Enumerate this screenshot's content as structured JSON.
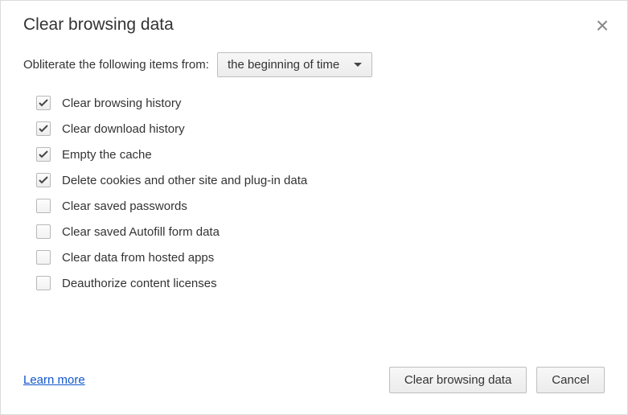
{
  "dialog": {
    "title": "Clear browsing data",
    "close_icon": "close-icon"
  },
  "prompt": {
    "label": "Obliterate the following items from:",
    "time_range_selected": "the beginning of time"
  },
  "options": [
    {
      "label": "Clear browsing history",
      "checked": true
    },
    {
      "label": "Clear download history",
      "checked": true
    },
    {
      "label": "Empty the cache",
      "checked": true
    },
    {
      "label": "Delete cookies and other site and plug-in data",
      "checked": true
    },
    {
      "label": "Clear saved passwords",
      "checked": false
    },
    {
      "label": "Clear saved Autofill form data",
      "checked": false
    },
    {
      "label": "Clear data from hosted apps",
      "checked": false
    },
    {
      "label": "Deauthorize content licenses",
      "checked": false
    }
  ],
  "footer": {
    "learn_more": "Learn more",
    "primary_button": "Clear browsing data",
    "cancel_button": "Cancel"
  }
}
